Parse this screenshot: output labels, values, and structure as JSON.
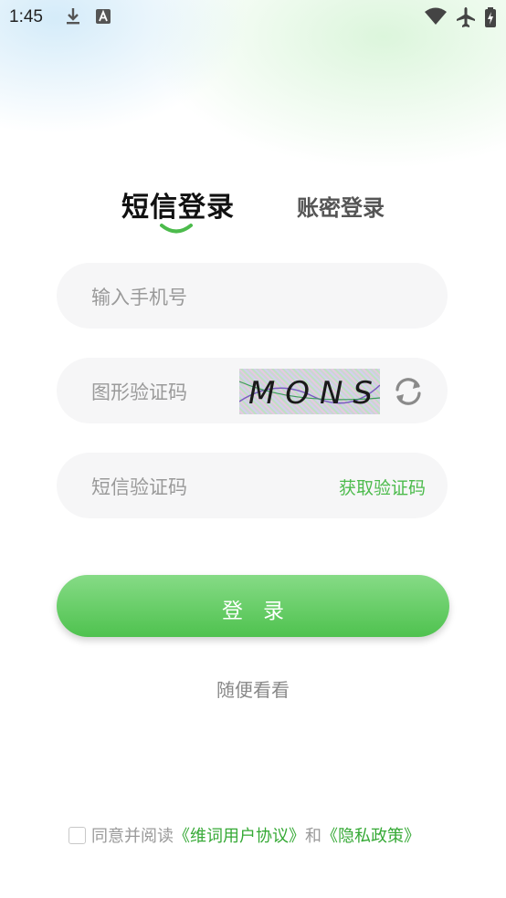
{
  "status_bar": {
    "time": "1:45"
  },
  "tabs": {
    "sms_login": "短信登录",
    "password_login": "账密登录"
  },
  "form": {
    "phone_placeholder": "输入手机号",
    "captcha_placeholder": "图形验证码",
    "captcha_text": "MONS",
    "sms_code_placeholder": "短信验证码",
    "get_code_label": "获取验证码"
  },
  "login_button": "登录",
  "browse_link": "随便看看",
  "agreement": {
    "prefix": "同意并阅读",
    "user_agreement": "《维词用户协议》",
    "and": "和",
    "privacy_policy": "《隐私政策》"
  },
  "colors": {
    "accent": "#4cbb4c",
    "button_top": "#86db86",
    "button_bottom": "#4fc24f"
  }
}
